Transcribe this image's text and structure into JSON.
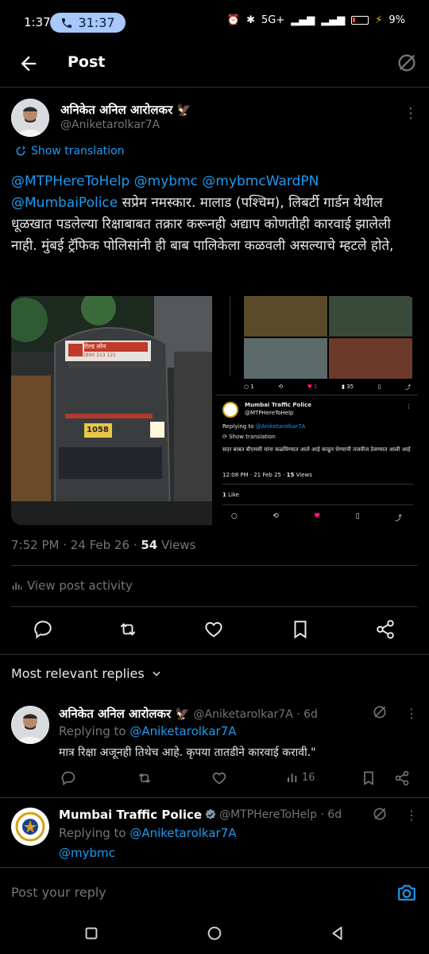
{
  "status_bar": {
    "time": "1:37",
    "call_duration": "31:37",
    "network": "5G+",
    "battery": "9%"
  },
  "header": {
    "title": "Post"
  },
  "post": {
    "author_name": "अनिकेत अनिल आरोलकर 🦅",
    "author_handle": "@Aniketarolkar7A",
    "show_translation": "Show translation",
    "mentions_1": "@MTPHereToHelp @mybmc @mybmcWardPN",
    "mentions_2": "@MumbaiPolice",
    "text": "सप्रेम नमस्कार. मालाड (पश्चिम), लिबर्टी गार्डन येथील धूळखात पडलेल्या रिक्षाबाबत तक्रार करूनही अद्याप कोणतीही कारवाई झालेली नाही. मुंबई ट्रॅफिक पोलिसांनी ही बाब पालिकेला कळवली असल्याचे म्हटले होते,",
    "timestamp": "7:52 PM · 24 Feb 26 · ",
    "views_count": "54",
    "views_label": " Views",
    "view_activity": "View post activity"
  },
  "embedded": {
    "sign_text": "गोल्ड लोन",
    "phone": "1800 313 121",
    "plate": "1058",
    "likes_count_top": "1",
    "views_top": "35",
    "author_name": "Mumbai Traffic Police",
    "author_handle": "@MTPHereToHelp",
    "replying_to_label": "Replying to ",
    "replying_to": "@Aniketarolkar7A",
    "show_translation": "Show translation",
    "text": "सदर बाबत बीएमसी यांना कळविण्यात आले आहे काढून घेण्याची तजवीज ठेवण्यात आली आहे",
    "timestamp": "12:08 PM · 21 Feb 25 · ",
    "views": "15",
    "views_label": " Views",
    "likes": "1",
    "likes_label": " Like"
  },
  "replies_filter": "Most relevant replies",
  "replies": [
    {
      "name": "अनिकेत अनिल आरोलकर 🦅",
      "meta": " @Aniketarolkar7A · 6d",
      "replying_label": "Replying to ",
      "replying_to": "@Aniketarolkar7A",
      "text": "मात्र रिक्षा अजूनही तिथेच आहे. कृपया तातडीने कारवाई करावी.\"",
      "views": "16"
    },
    {
      "name": "Mumbai Traffic Police",
      "meta": " @MTPHereToHelp · 6d",
      "replying_label": "Replying to ",
      "replying_to": "@Aniketarolkar7A",
      "text": "@mybmc"
    }
  ],
  "reply_box": {
    "placeholder": "Post your reply"
  },
  "colors": {
    "accent": "#1d9bf0",
    "like": "#f91880",
    "verified": "#829aab"
  }
}
